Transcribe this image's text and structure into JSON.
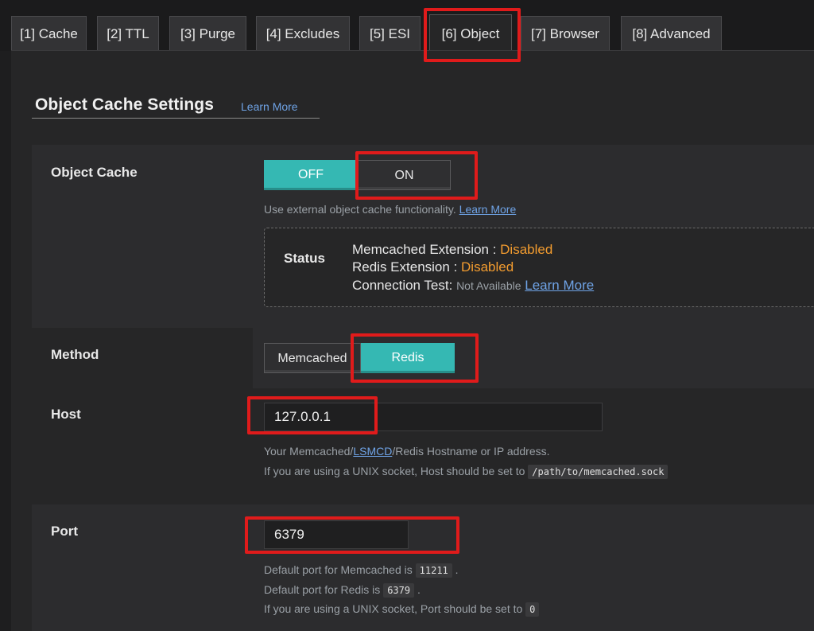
{
  "tabs": [
    {
      "label": "[1] Cache"
    },
    {
      "label": "[2] TTL"
    },
    {
      "label": "[3] Purge"
    },
    {
      "label": "[4] Excludes"
    },
    {
      "label": "[5] ESI"
    },
    {
      "label": "[6] Object"
    },
    {
      "label": "[7] Browser"
    },
    {
      "label": "[8] Advanced"
    }
  ],
  "section": {
    "title": "Object Cache Settings",
    "learn_more": "Learn More"
  },
  "object_cache": {
    "label": "Object Cache",
    "off_label": "OFF",
    "on_label": "ON",
    "hint": "Use external object cache functionality.",
    "hint_link": "Learn More"
  },
  "status": {
    "title": "Status",
    "memcached_label": "Memcached Extension :",
    "memcached_value": "Disabled",
    "redis_label": "Redis Extension :",
    "redis_value": "Disabled",
    "conn_label": "Connection Test:",
    "conn_value": "Not Available",
    "conn_link": "Learn More"
  },
  "method": {
    "label": "Method",
    "memcached_label": "Memcached",
    "redis_label": "Redis"
  },
  "host": {
    "label": "Host",
    "value": "127.0.0.1",
    "hint1_pre": "Your Memcached/",
    "hint1_link": "LSMCD",
    "hint1_post": "/Redis Hostname or IP address.",
    "hint2": "If you are using a UNIX socket, Host should be set to",
    "hint2_code": "/path/to/memcached.sock"
  },
  "port": {
    "label": "Port",
    "value": "6379",
    "hint1": "Default port for Memcached is",
    "hint1_code": "11211",
    "hint2": "Default port for Redis is",
    "hint2_code": "6379",
    "hint3": "If you are using a UNIX socket, Port should be set to",
    "hint3_code": "0",
    "period": "."
  },
  "colors": {
    "accent": "#35b8b3",
    "highlight": "#e01b1b",
    "warning": "#f39c2f",
    "link": "#6fa3e6"
  }
}
